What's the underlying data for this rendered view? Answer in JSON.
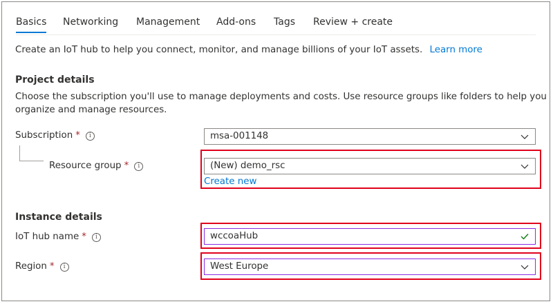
{
  "tabs": [
    {
      "label": "Basics",
      "active": true
    },
    {
      "label": "Networking"
    },
    {
      "label": "Management"
    },
    {
      "label": "Add-ons"
    },
    {
      "label": "Tags"
    },
    {
      "label": "Review + create"
    }
  ],
  "intro": {
    "text": "Create an IoT hub to help you connect, monitor, and manage billions of your IoT assets.",
    "learn_more": "Learn more"
  },
  "project": {
    "heading": "Project details",
    "desc_line1": "Choose the subscription you'll use to manage deployments and costs. Use resource groups like folders to help you",
    "desc_line2": "organize and manage resources.",
    "subscription": {
      "label": "Subscription",
      "required": "*",
      "value": "msa-001148"
    },
    "resource_group": {
      "label": "Resource group",
      "required": "*",
      "value": "(New) demo_rsc",
      "create_new": "Create new"
    }
  },
  "instance": {
    "heading": "Instance details",
    "hub_name": {
      "label": "IoT hub name",
      "required": "*",
      "value": "wccoaHub"
    },
    "region": {
      "label": "Region",
      "required": "*",
      "value": "West Europe"
    }
  },
  "colors": {
    "accent": "#0078d4",
    "highlight": "#e0001b",
    "valid": "#107c10"
  },
  "icons": {
    "info": "info-icon",
    "dropdown": "chevron-down-icon",
    "valid": "checkmark-icon"
  }
}
